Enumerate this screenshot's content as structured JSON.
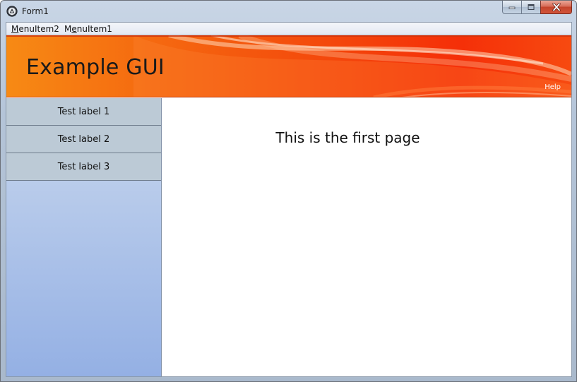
{
  "window": {
    "title": "Form1",
    "icon": "app-logo-icon",
    "controls": [
      "minimize-icon",
      "maximize-icon",
      "close-icon"
    ]
  },
  "menubar": {
    "items": [
      {
        "label": "MenuItem2",
        "mnemonic": "M"
      },
      {
        "label": "MenuItem1",
        "mnemonic": "e"
      }
    ]
  },
  "header": {
    "title": "Example GUI",
    "help_label": "Help",
    "colors": {
      "orange": "#f78a14",
      "red": "#f44a0c"
    }
  },
  "sidebar": {
    "items": [
      {
        "label": "Test label 1"
      },
      {
        "label": "Test label 2"
      },
      {
        "label": "Test label 3"
      }
    ]
  },
  "main": {
    "heading": "This is the first page"
  }
}
